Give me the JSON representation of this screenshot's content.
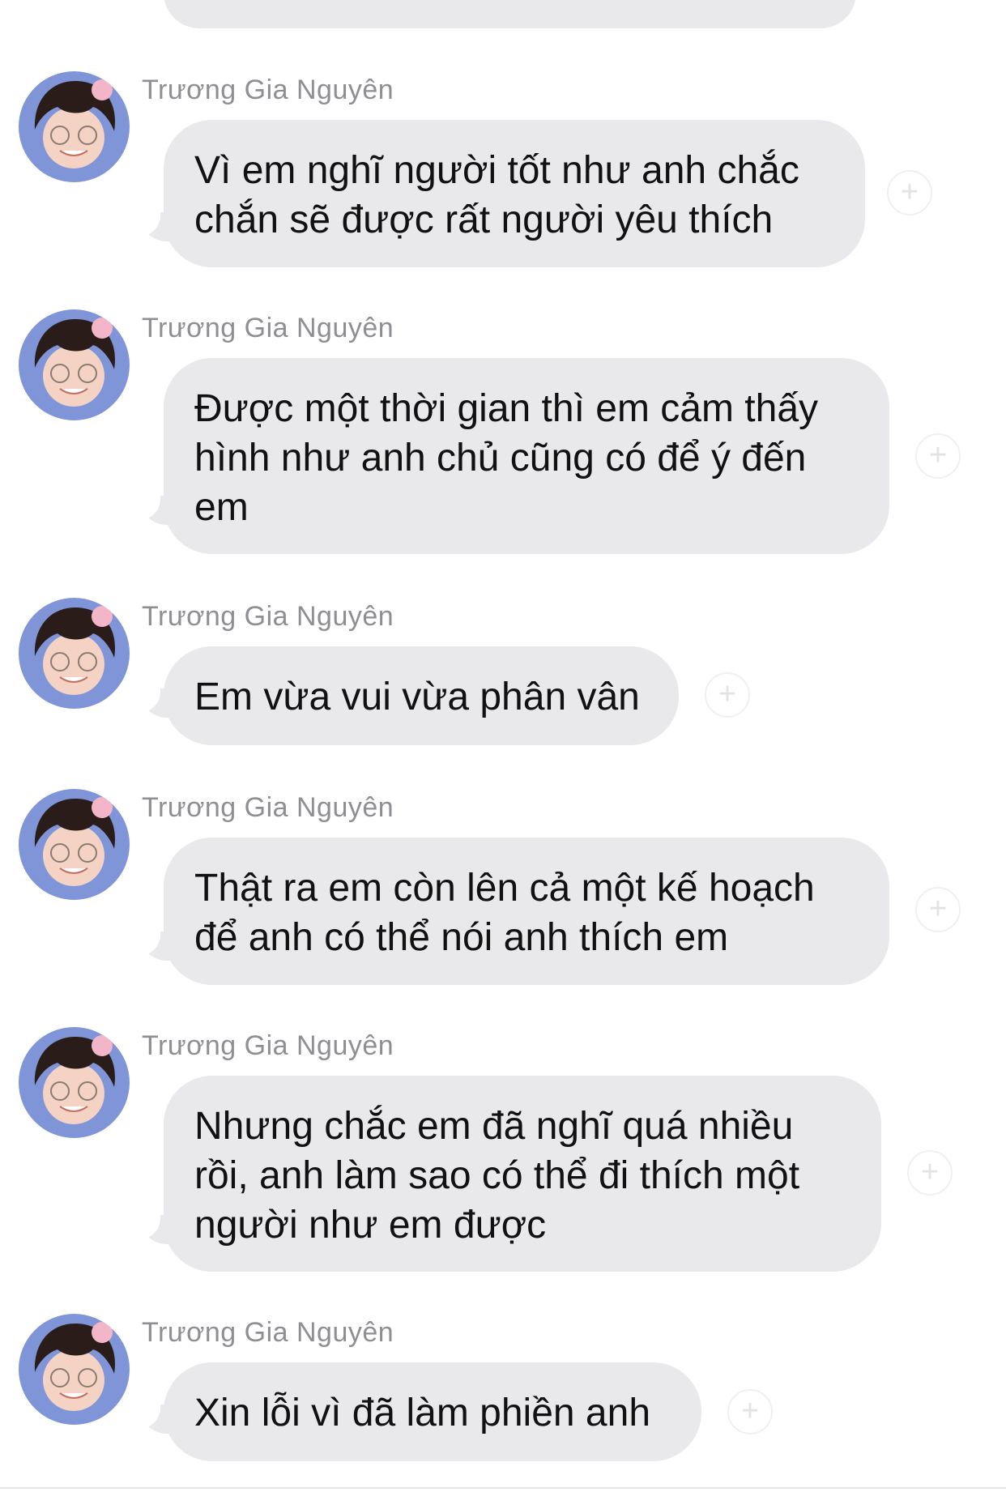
{
  "conversation": {
    "messages": [
      {
        "sender": "Trương Gia Nguyên",
        "text": "Vì em nghĩ người tốt như anh chắc chắn sẽ được rất người yêu thích"
      },
      {
        "sender": "Trương Gia Nguyên",
        "text": "Được một thời gian thì em cảm thấy hình như anh chủ cũng có để ý đến em"
      },
      {
        "sender": "Trương Gia Nguyên",
        "text": "Em vừa vui vừa phân vân"
      },
      {
        "sender": "Trương Gia Nguyên",
        "text": "Thật ra em còn lên cả một kế hoạch để anh có thể nói anh thích em"
      },
      {
        "sender": "Trương Gia Nguyên",
        "text": "Nhưng chắc em đã nghĩ quá nhiều rồi, anh làm sao có thể đi thích một người như em được"
      },
      {
        "sender": "Trương Gia Nguyên",
        "text": "Xin lỗi vì đã làm phiền anh"
      }
    ]
  },
  "icons": {
    "avatar": "avatar-photo",
    "reaction": "add-reaction-icon"
  },
  "colors": {
    "bubble": "#e9e9eb",
    "sender_name": "#8e8e93",
    "avatar_background": "#7f95d8"
  }
}
